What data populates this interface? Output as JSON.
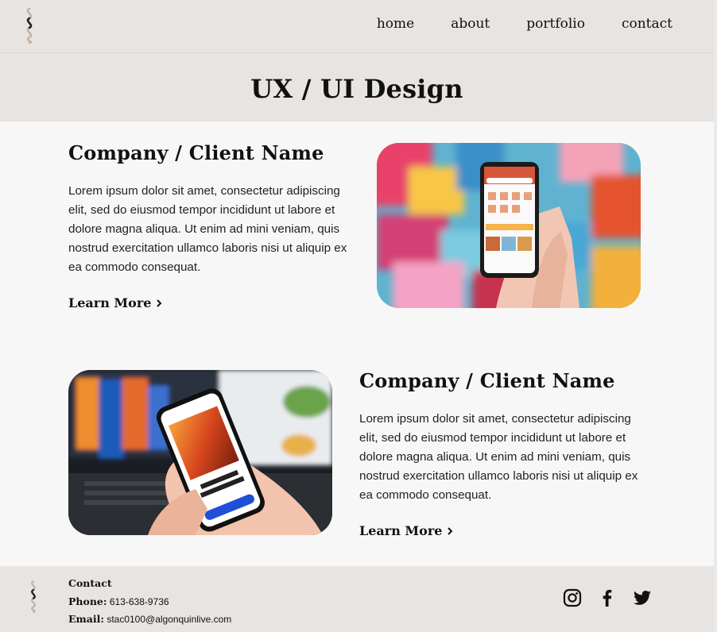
{
  "nav": {
    "items": [
      "home",
      "about",
      "portfolio",
      "contact"
    ]
  },
  "hero": {
    "title": "UX / UI Design"
  },
  "projects": [
    {
      "title": "Company / Client Name",
      "description": "Lorem ipsum dolor sit amet, consectetur adipiscing elit, sed do eiusmod tempor incididunt ut labore et dolore magna aliqua. Ut enim ad mini veniam, quis nostrud exercitation ullamco laboris nisi ut  aliquip ex ea commodo consequat.",
      "cta": "Learn More",
      "image_alt": "hand-holding-phone-colorful-mural"
    },
    {
      "title": "Company / Client Name",
      "description": "Lorem ipsum dolor sit amet, consectetur adipiscing elit, sed do eiusmod tempor incididunt ut labore et dolore magna aliqua. Ut enim ad mini veniam, quis nostrud exercitation ullamco laboris nisi ut  aliquip ex ea commodo consequat.",
      "cta": "Learn More",
      "image_alt": "hand-holding-phone-travel-app"
    }
  ],
  "footer": {
    "contact_heading": "Contact",
    "phone_label": "Phone:",
    "phone": "613-638-9736",
    "email_label": "Email:",
    "email": "stac0100@algonquinlive.com"
  },
  "icons": {
    "logo": "wave-s-logo",
    "social": [
      "instagram-icon",
      "facebook-icon",
      "twitter-icon"
    ],
    "cta": "chevron-right-icon"
  },
  "colors": {
    "header_bg": "#e8e4e1",
    "page_bg": "#f7f7f7",
    "text": "#111111"
  }
}
